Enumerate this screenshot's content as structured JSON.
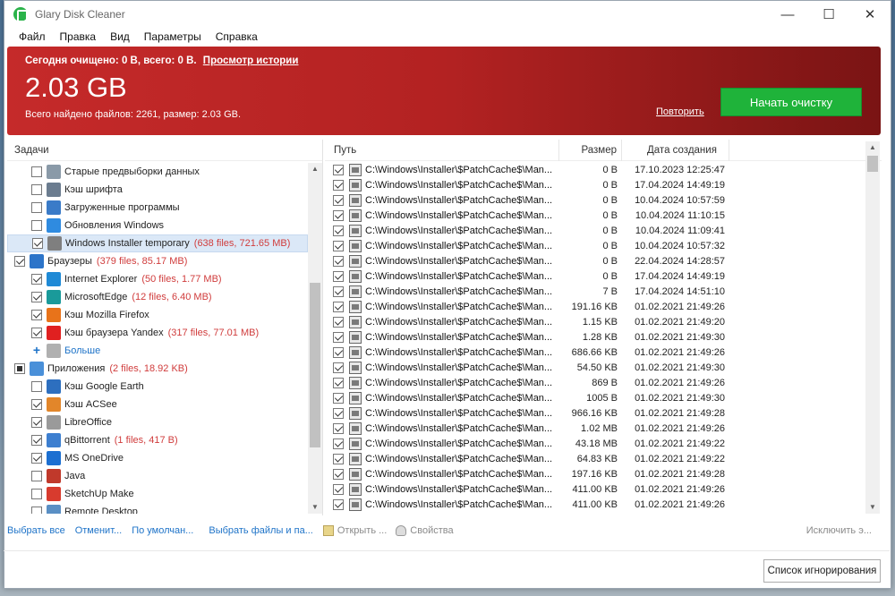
{
  "window": {
    "title": "Glary Disk Cleaner",
    "minimize": "—",
    "maximize": "☐",
    "close": "✕"
  },
  "menu": [
    "Файл",
    "Правка",
    "Вид",
    "Параметры",
    "Справка"
  ],
  "banner": {
    "stats": "Сегодня очищено: 0 B, всего: 0 B.",
    "history_link": "Просмотр истории",
    "total_size": "2.03 GB",
    "found": "Всего найдено файлов: 2261, размер: 2.03 GB.",
    "repeat_link": "Повторить",
    "start_button": "Начать очистку",
    "colors": {
      "banner": "#b32222",
      "start_button": "#1fb33a"
    }
  },
  "tasks": {
    "header": "Задачи",
    "items": [
      {
        "level": 1,
        "checked": "off",
        "icon": "thumbnail-icon",
        "label": "Старые предвыборки данных",
        "stat": ""
      },
      {
        "level": 1,
        "checked": "off",
        "icon": "font-icon",
        "label": "Кэш шрифта",
        "stat": ""
      },
      {
        "level": 1,
        "checked": "off",
        "icon": "download-icon",
        "label": "Загруженные программы",
        "stat": ""
      },
      {
        "level": 1,
        "checked": "off",
        "icon": "windows-icon",
        "label": "Обновления Windows",
        "stat": ""
      },
      {
        "level": 1,
        "checked": "on",
        "icon": "installer-icon",
        "label": "Windows Installer temporary",
        "stat": "(638 files, 721.65 MB)",
        "selected": true
      },
      {
        "level": 0,
        "checked": "on",
        "icon": "globe-icon",
        "label": "Браузеры",
        "stat": "(379 files, 85.17 MB)"
      },
      {
        "level": 1,
        "checked": "on",
        "icon": "ie-icon",
        "label": "Internet Explorer",
        "stat": "(50 files, 1.77 MB)"
      },
      {
        "level": 1,
        "checked": "on",
        "icon": "edge-icon",
        "label": "MicrosoftEdge",
        "stat": "(12 files, 6.40 MB)"
      },
      {
        "level": 1,
        "checked": "on",
        "icon": "firefox-icon",
        "label": "Кэш Mozilla Firefox",
        "stat": ""
      },
      {
        "level": 1,
        "checked": "on",
        "icon": "yandex-icon",
        "label": "Кэш браузера Yandex",
        "stat": "(317 files, 77.01 MB)"
      },
      {
        "level": 1,
        "checked": "more",
        "icon": "drive-icon",
        "label": "Больше",
        "stat": ""
      },
      {
        "level": 0,
        "checked": "partial",
        "icon": "apps-icon",
        "label": "Приложения",
        "stat": "(2 files, 18.92 KB)"
      },
      {
        "level": 1,
        "checked": "off",
        "icon": "google-earth-icon",
        "label": "Кэш Google Earth",
        "stat": ""
      },
      {
        "level": 1,
        "checked": "on",
        "icon": "acdsee-icon",
        "label": "Кэш ACSee",
        "stat": ""
      },
      {
        "level": 1,
        "checked": "on",
        "icon": "libreoffice-icon",
        "label": "LibreOffice",
        "stat": ""
      },
      {
        "level": 1,
        "checked": "on",
        "icon": "qbittorrent-icon",
        "label": "qBittorrent",
        "stat": "(1 files, 417 B)"
      },
      {
        "level": 1,
        "checked": "on",
        "icon": "onedrive-icon",
        "label": "MS OneDrive",
        "stat": ""
      },
      {
        "level": 1,
        "checked": "off",
        "icon": "java-icon",
        "label": "Java",
        "stat": ""
      },
      {
        "level": 1,
        "checked": "off",
        "icon": "sketchup-icon",
        "label": "SketchUp Make",
        "stat": ""
      },
      {
        "level": 1,
        "checked": "off",
        "icon": "remote-desktop-icon",
        "label": "Remote Desktop",
        "stat": ""
      }
    ]
  },
  "files": {
    "columns": {
      "path": "Путь",
      "size": "Размер",
      "date": "Дата создания"
    },
    "rows": [
      {
        "path": "C:\\Windows\\Installer\\$PatchCache$\\Man...",
        "size": "0 B",
        "date": "17.10.2023 12:25:47"
      },
      {
        "path": "C:\\Windows\\Installer\\$PatchCache$\\Man...",
        "size": "0 B",
        "date": "17.04.2024 14:49:19"
      },
      {
        "path": "C:\\Windows\\Installer\\$PatchCache$\\Man...",
        "size": "0 B",
        "date": "10.04.2024 10:57:59"
      },
      {
        "path": "C:\\Windows\\Installer\\$PatchCache$\\Man...",
        "size": "0 B",
        "date": "10.04.2024 11:10:15"
      },
      {
        "path": "C:\\Windows\\Installer\\$PatchCache$\\Man...",
        "size": "0 B",
        "date": "10.04.2024 11:09:41"
      },
      {
        "path": "C:\\Windows\\Installer\\$PatchCache$\\Man...",
        "size": "0 B",
        "date": "10.04.2024 10:57:32"
      },
      {
        "path": "C:\\Windows\\Installer\\$PatchCache$\\Man...",
        "size": "0 B",
        "date": "22.04.2024 14:28:57"
      },
      {
        "path": "C:\\Windows\\Installer\\$PatchCache$\\Man...",
        "size": "0 B",
        "date": "17.04.2024 14:49:19"
      },
      {
        "path": "C:\\Windows\\Installer\\$PatchCache$\\Man...",
        "size": "7 B",
        "date": "17.04.2024 14:51:10"
      },
      {
        "path": "C:\\Windows\\Installer\\$PatchCache$\\Man...",
        "size": "191.16 KB",
        "date": "01.02.2021 21:49:26"
      },
      {
        "path": "C:\\Windows\\Installer\\$PatchCache$\\Man...",
        "size": "1.15 KB",
        "date": "01.02.2021 21:49:20"
      },
      {
        "path": "C:\\Windows\\Installer\\$PatchCache$\\Man...",
        "size": "1.28 KB",
        "date": "01.02.2021 21:49:30"
      },
      {
        "path": "C:\\Windows\\Installer\\$PatchCache$\\Man...",
        "size": "686.66 KB",
        "date": "01.02.2021 21:49:26"
      },
      {
        "path": "C:\\Windows\\Installer\\$PatchCache$\\Man...",
        "size": "54.50 KB",
        "date": "01.02.2021 21:49:30"
      },
      {
        "path": "C:\\Windows\\Installer\\$PatchCache$\\Man...",
        "size": "869 B",
        "date": "01.02.2021 21:49:26"
      },
      {
        "path": "C:\\Windows\\Installer\\$PatchCache$\\Man...",
        "size": "1005 B",
        "date": "01.02.2021 21:49:30"
      },
      {
        "path": "C:\\Windows\\Installer\\$PatchCache$\\Man...",
        "size": "966.16 KB",
        "date": "01.02.2021 21:49:28"
      },
      {
        "path": "C:\\Windows\\Installer\\$PatchCache$\\Man...",
        "size": "1.02 MB",
        "date": "01.02.2021 21:49:26"
      },
      {
        "path": "C:\\Windows\\Installer\\$PatchCache$\\Man...",
        "size": "43.18 MB",
        "date": "01.02.2021 21:49:22"
      },
      {
        "path": "C:\\Windows\\Installer\\$PatchCache$\\Man...",
        "size": "64.83 KB",
        "date": "01.02.2021 21:49:22"
      },
      {
        "path": "C:\\Windows\\Installer\\$PatchCache$\\Man...",
        "size": "197.16 KB",
        "date": "01.02.2021 21:49:28"
      },
      {
        "path": "C:\\Windows\\Installer\\$PatchCache$\\Man...",
        "size": "411.00 KB",
        "date": "01.02.2021 21:49:26"
      },
      {
        "path": "C:\\Windows\\Installer\\$PatchCache$\\Man...",
        "size": "411.00 KB",
        "date": "01.02.2021 21:49:26"
      },
      {
        "path": "C:\\Windows\\Installer\\$PatchCache$\\Man...",
        "size": "",
        "date": ""
      }
    ]
  },
  "bottom": {
    "select_all": "Выбрать все",
    "cancel": "Отменит...",
    "default": "По умолчан...",
    "select_files": "Выбрать файлы и па...",
    "open": "Открыть ...",
    "properties": "Свойства",
    "exclude": "Исключить э..."
  },
  "footer": {
    "ignore_button": "Список игнорирования"
  }
}
